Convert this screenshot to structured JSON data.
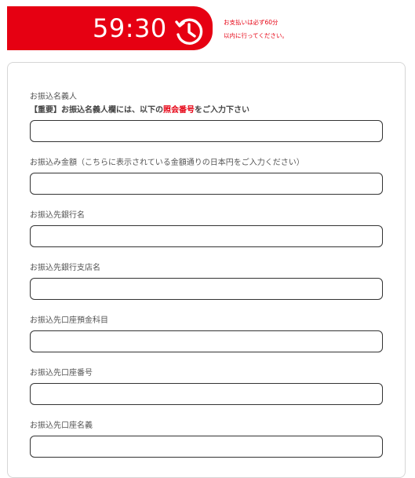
{
  "timer": {
    "remaining": "59:30",
    "icon": "clock-history-icon"
  },
  "notice": {
    "line1": "お支払いは必ず60分",
    "line2": "以内に行ってください。"
  },
  "colors": {
    "accent": "#e60012",
    "input_border": "#333333",
    "card_border": "#d6d6d6"
  },
  "form": {
    "fields": [
      {
        "label": "お振込名義人",
        "note_prefix": "【重要】お振込名義人欄には、以下の",
        "note_highlight": "照会番号",
        "note_suffix": "をご入力下さい",
        "value": "",
        "placeholder": ""
      },
      {
        "label": "お振込み金額（こちらに表示されている金額通りの日本円をご入力ください）",
        "value": "",
        "placeholder": ""
      },
      {
        "label": "お振込先銀行名",
        "value": "",
        "placeholder": ""
      },
      {
        "label": "お振込先銀行支店名",
        "value": "",
        "placeholder": ""
      },
      {
        "label": "お振込先口座預金科目",
        "value": "",
        "placeholder": ""
      },
      {
        "label": "お振込先口座番号",
        "value": "",
        "placeholder": ""
      },
      {
        "label": "お振込先口座名義",
        "value": "",
        "placeholder": ""
      }
    ]
  }
}
